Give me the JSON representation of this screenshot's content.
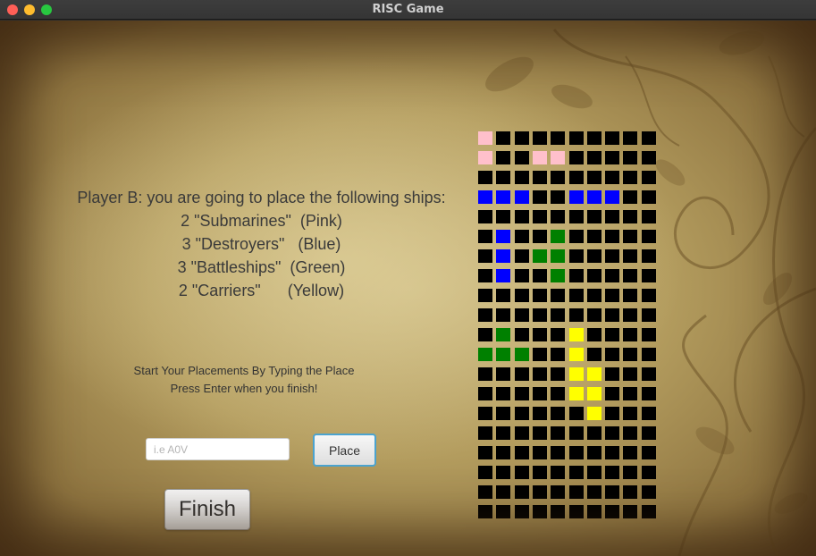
{
  "window": {
    "title": "RISC Game"
  },
  "instructions": {
    "heading": "Player B: you are going to place the following ships:",
    "ships": [
      {
        "count": "2",
        "name": "\"Submarines\"",
        "color_name": "(Pink)",
        "color": "#ffc0cb"
      },
      {
        "count": "3",
        "name": "\"Destroyers\"",
        "color_name": "(Blue)",
        "color": "#0000ff"
      },
      {
        "count": "3",
        "name": "\"Battleships\"",
        "color_name": "(Green)",
        "color": "#008000"
      },
      {
        "count": "2",
        "name": "\"Carriers\"",
        "color_name": "(Yellow)",
        "color": "#ffff00"
      }
    ],
    "ship_lines": [
      "2 \"Submarines\"  (Pink)",
      "3 \"Destroyers\"   (Blue)",
      "3 \"Battleships\"  (Green)",
      "2 \"Carriers\"      (Yellow)"
    ]
  },
  "prompt": {
    "line1": "Start Your Placements By Typing the Place",
    "line2": "Press Enter when you finish!"
  },
  "input": {
    "placeholder": "i.e A0V",
    "value": ""
  },
  "buttons": {
    "place_label": "Place",
    "finish_label": "Finish"
  },
  "board": {
    "rows": 20,
    "cols": 10,
    "empty_color": "#000000",
    "grid_rows": [
      "P.........",
      "P..PP.....",
      "..........",
      "BBB..BBB..",
      "..........",
      ".B..G.....",
      ".B.GG.....",
      ".B..G.....",
      "..........",
      "..........",
      ".G...Y....",
      "GGG..Y....",
      ".....YY...",
      ".....YY...",
      "......Y...",
      "..........",
      "..........",
      "..........",
      "..........",
      ".........."
    ],
    "legend": {
      "P": "#ffc0cb",
      "B": "#0000ff",
      "G": "#008000",
      "Y": "#ffff00"
    }
  }
}
